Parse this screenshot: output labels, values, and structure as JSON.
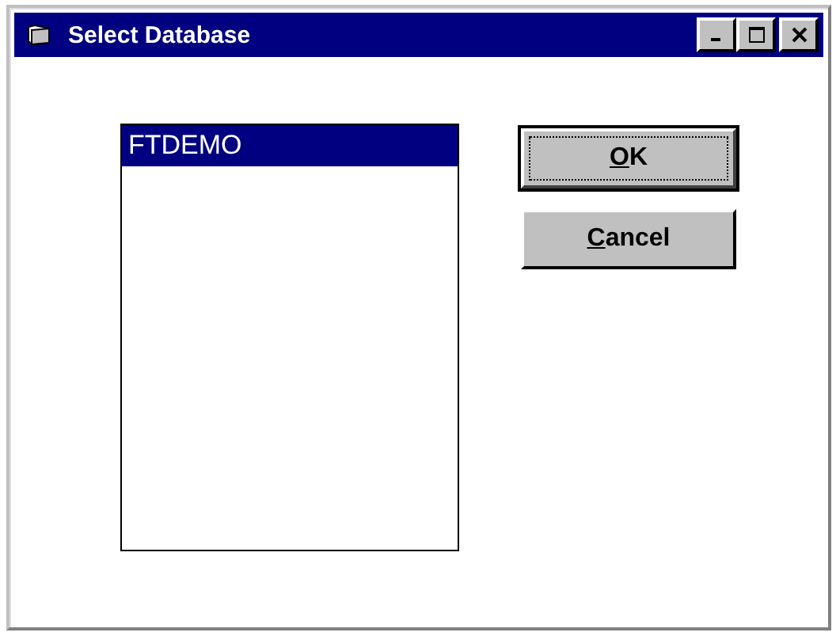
{
  "window": {
    "title": "Select Database"
  },
  "list": {
    "items": [
      {
        "label": "FTDEMO",
        "selected": true
      }
    ]
  },
  "buttons": [
    {
      "mnemonic": "O",
      "rest": "K",
      "default": true
    },
    {
      "mnemonic": "C",
      "rest": "ancel",
      "default": false
    }
  ]
}
